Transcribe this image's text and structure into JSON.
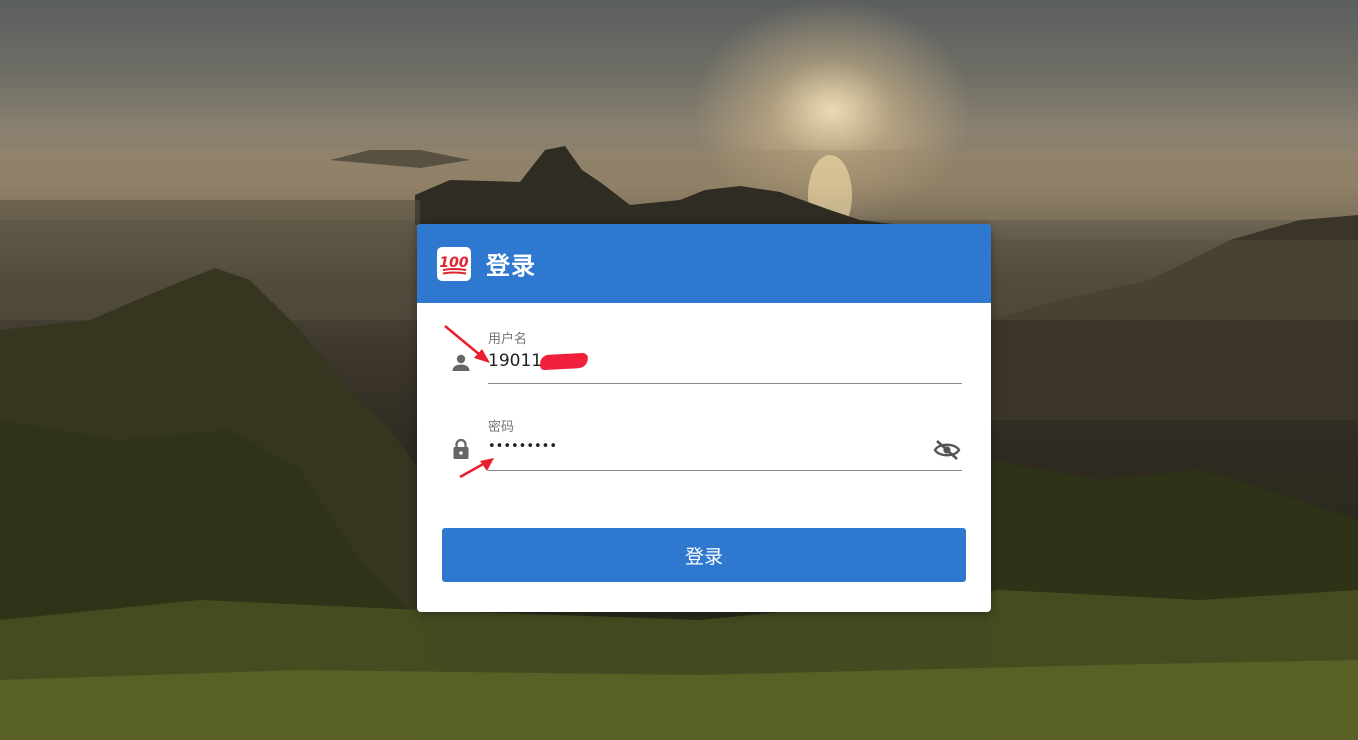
{
  "login": {
    "title": "登录",
    "logo_icon": "hundred-points-icon",
    "username": {
      "label": "用户名",
      "value": "19011",
      "icon": "person-icon"
    },
    "password": {
      "label": "密码",
      "value": "•••••••••",
      "icon": "lock-icon",
      "toggle_icon": "eye-off-icon"
    },
    "submit_label": "登录"
  },
  "colors": {
    "primary": "#2f78d0",
    "annotation": "#e8202d",
    "card_background": "#ffffff"
  }
}
